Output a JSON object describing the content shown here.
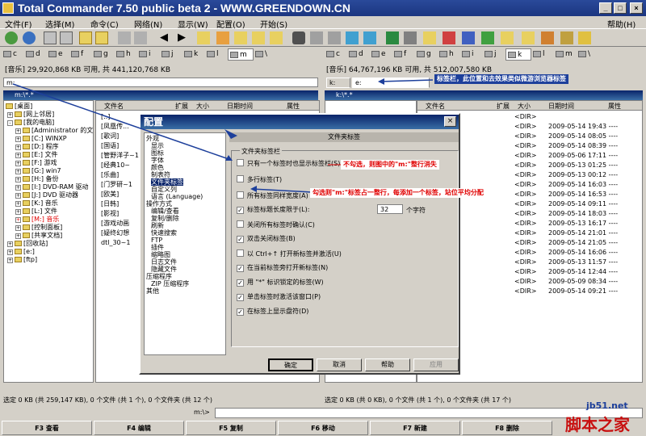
{
  "window": {
    "title": "Total Commander 7.50 public beta 2 - WWW.GREENDOWN.CN",
    "min": "_",
    "max": "□",
    "close": "×"
  },
  "menu": {
    "items": [
      "文件(F)",
      "选择(M)",
      "命令(C)",
      "网络(N)",
      "显示(W)",
      "配置(O)",
      "开始(S)"
    ],
    "help": "帮助(H)"
  },
  "drives": [
    "c",
    "d",
    "e",
    "f",
    "g",
    "h",
    "i",
    "j",
    "k",
    "l",
    "m",
    "\\"
  ],
  "left": {
    "info": "[音乐]  29,920,868 KB 可用, 共 441,120,768 KB",
    "tab": "m:",
    "path": "m:\\*.*",
    "tree": [
      "[桌面]",
      "[网上邻居]",
      "[我的电脑]",
      "[Administrator 的文",
      "[C:] WINXP",
      "[D:] 程序",
      "[E:] 文件",
      "[F:] 游戏",
      "[G:] win7",
      "[H:] 备份",
      "[I:] DVD-RAM 驱动",
      "[J:] DVD 驱动器",
      "[K:] 音乐",
      "[L:] 文件",
      "[M:] 音乐",
      "[控制面板]",
      "[共享文档]",
      "[回收站]",
      "[e:]",
      "[ftp]"
    ],
    "columns": [
      "文件名",
      "扩展",
      "大小",
      "日期时间",
      "属性"
    ],
    "files": [
      "[..]",
      "[凤凰传...",
      "[歌词]",
      "[国语]",
      "[管野洋子~1",
      "[经典10~",
      "[乐曲]",
      "[门罗研~1",
      "[欧美]",
      "[日韩]",
      "[影视]",
      "[游戏动画",
      "[疑终幻想",
      "dtl_30~1"
    ],
    "status": "选定 0 KB (共 259,147 KB), 0 个文件 (共 1 个), 0 个文件夹 (共 12 个)"
  },
  "right": {
    "info": "[音乐]  64,767,196 KB 可用, 共 512,007,580 KB",
    "tabs": [
      "k:",
      "e:"
    ],
    "path": "k:\\*.*",
    "columns": [
      "文件名",
      "扩展",
      "大小",
      "日期时间",
      "属性"
    ],
    "rows": [
      {
        "size": "<DIR>",
        "date": ""
      },
      {
        "size": "<DIR>",
        "date": "2009-05-14 19:43 ----"
      },
      {
        "size": "<DIR>",
        "date": "2009-05-14 08:05 ----"
      },
      {
        "size": "<DIR>",
        "date": "2009-05-14 08:39 ----"
      },
      {
        "size": "<DIR>",
        "date": "2009-05-06 17:11 ----"
      },
      {
        "size": "<DIR>",
        "date": "2009-05-13 01:25 ----"
      },
      {
        "size": "<DIR>",
        "date": "2009-05-13 00:12 ----"
      },
      {
        "size": "<DIR>",
        "date": "2009-05-14 16:03 ----"
      },
      {
        "size": "<DIR>",
        "date": "2009-05-14 16:53 ----"
      },
      {
        "size": "<DIR>",
        "date": "2009-05-14 09:11 ----"
      },
      {
        "size": "<DIR>",
        "date": "2009-05-14 18:03 ----"
      },
      {
        "size": "<DIR>",
        "date": "2009-05-13 16:17 ----"
      },
      {
        "size": "<DIR>",
        "date": "2009-05-14 21:01 ----"
      },
      {
        "size": "<DIR>",
        "date": "2009-05-14 21:05 ----"
      },
      {
        "size": "<DIR>",
        "date": "2009-05-14 16:06 ----"
      },
      {
        "size": "<DIR>",
        "date": "2009-05-13 11:57 ----"
      },
      {
        "size": "<DIR>",
        "date": "2009-05-14 12:44 ----"
      },
      {
        "size": "<DIR>",
        "date": "2009-05-09 08:34 ----"
      },
      {
        "size": "<DIR>",
        "date": "2009-05-14 09:21 ----"
      }
    ],
    "status": "选定 0 KB (共 0 KB), 0 个文件 (共 1 个), 0 个文件夹 (共 17 个)"
  },
  "cmdline": {
    "label": "m:\\>",
    "value": ""
  },
  "fkeys": [
    "F3 查看",
    "F4 编辑",
    "F5 复制",
    "F6 移动",
    "F7 新建",
    "F8 删除"
  ],
  "dialog": {
    "title": "配置",
    "close": "×",
    "nav": [
      "外观",
      "显示",
      "图标",
      "字体",
      "颜色",
      "制表符",
      "文件夹标签",
      "自定义列",
      "语言 (Language)",
      "操作方式",
      "编辑/查看",
      "复制/删除",
      "刷新",
      "快速搜索",
      "FTP",
      "插件",
      "缩略图",
      "日志文件",
      "隐藏文件",
      "压缩程序",
      "ZIP 压缩程序",
      "其他"
    ],
    "selected_nav": "文件夹标签",
    "section_header": "文件夹标签",
    "group_label": "文件夹标签栏",
    "options": [
      {
        "label": "只有一个标签时也显示标签栏(S)",
        "checked": false
      },
      {
        "label": "多行标签(T)",
        "checked": false
      },
      {
        "label": "所有标签同样宽度(A)",
        "checked": false
      },
      {
        "label": "标签标题长度限于(L):",
        "checked": true
      },
      {
        "label": "关闭所有标签时确认(C)",
        "checked": false
      },
      {
        "label": "双击关闭标签(B)",
        "checked": true
      },
      {
        "label": "以 Ctrl+↑ 打开新标签并激活(U)",
        "checked": false
      },
      {
        "label": "在当前标签旁打开新标签(N)",
        "checked": true
      },
      {
        "label": "用 \"*\" 标识锁定的标签(W)",
        "checked": true
      },
      {
        "label": "单击标签时激活该窗口(P)",
        "checked": true
      },
      {
        "label": "在标签上显示盘符(D)",
        "checked": true
      }
    ],
    "length_value": "32",
    "length_unit": "个字符",
    "buttons": [
      "确定",
      "取消",
      "帮助",
      "应用"
    ]
  },
  "annotations": {
    "top": "标签栏，此位置和去效果类似微游浏览器标签",
    "uncheck": "不勾选，则图中的\"m:\"整行消失",
    "check": "勾选则\"m:\"标签占一整行，每添加一个标签，站位平均分配"
  },
  "watermark": {
    "site": "jb51.net",
    "brand": "脚本之家"
  }
}
